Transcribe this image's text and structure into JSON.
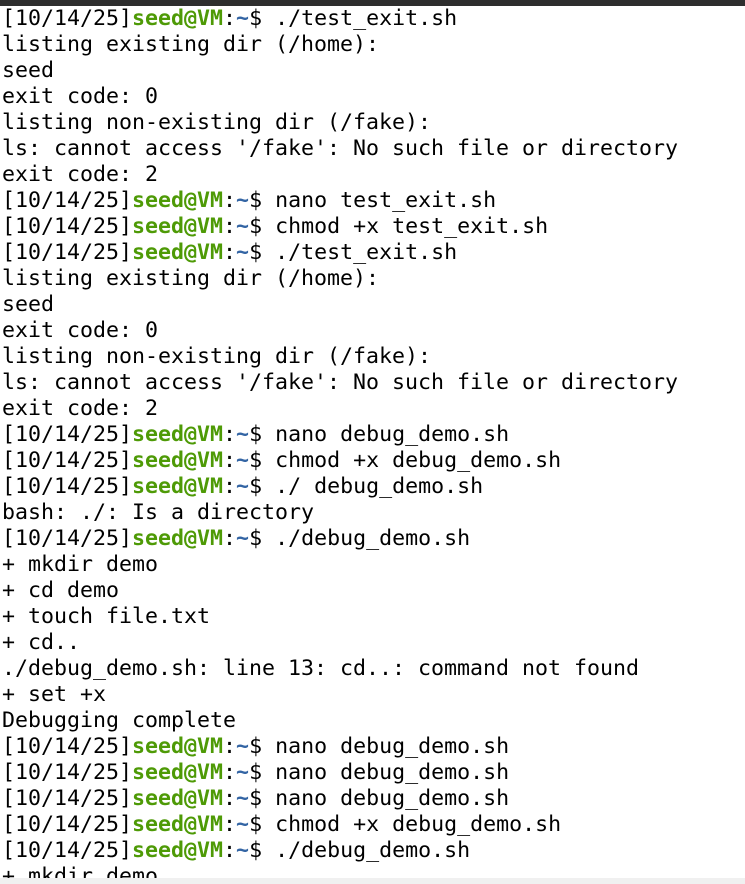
{
  "terminal": {
    "prompt": {
      "date": "[10/14/25]",
      "user_host": "seed@VM",
      "separator": ":",
      "cwd": "~",
      "symbol": "$ "
    },
    "lines": [
      {
        "kind": "prompt",
        "cmd": "./test_exit.sh"
      },
      {
        "kind": "out",
        "text": "listing existing dir (/home):"
      },
      {
        "kind": "out",
        "text": "seed"
      },
      {
        "kind": "out",
        "text": "exit code: 0"
      },
      {
        "kind": "out",
        "text": "listing non-existing dir (/fake):"
      },
      {
        "kind": "out",
        "text": "ls: cannot access '/fake': No such file or directory"
      },
      {
        "kind": "out",
        "text": "exit code: 2"
      },
      {
        "kind": "prompt",
        "cmd": "nano test_exit.sh"
      },
      {
        "kind": "prompt",
        "cmd": "chmod +x test_exit.sh"
      },
      {
        "kind": "prompt",
        "cmd": "./test_exit.sh"
      },
      {
        "kind": "out",
        "text": "listing existing dir (/home):"
      },
      {
        "kind": "out",
        "text": "seed"
      },
      {
        "kind": "out",
        "text": "exit code: 0"
      },
      {
        "kind": "out",
        "text": "listing non-existing dir (/fake):"
      },
      {
        "kind": "out",
        "text": "ls: cannot access '/fake': No such file or directory"
      },
      {
        "kind": "out",
        "text": "exit code: 2"
      },
      {
        "kind": "prompt",
        "cmd": "nano debug_demo.sh"
      },
      {
        "kind": "prompt",
        "cmd": "chmod +x debug_demo.sh"
      },
      {
        "kind": "prompt",
        "cmd": "./ debug_demo.sh"
      },
      {
        "kind": "out",
        "text": "bash: ./: Is a directory"
      },
      {
        "kind": "prompt",
        "cmd": "./debug_demo.sh"
      },
      {
        "kind": "out",
        "text": "+ mkdir demo"
      },
      {
        "kind": "out",
        "text": "+ cd demo"
      },
      {
        "kind": "out",
        "text": "+ touch file.txt"
      },
      {
        "kind": "out",
        "text": "+ cd.."
      },
      {
        "kind": "out",
        "text": "./debug_demo.sh: line 13: cd..: command not found"
      },
      {
        "kind": "out",
        "text": "+ set +x"
      },
      {
        "kind": "out",
        "text": "Debugging complete"
      },
      {
        "kind": "prompt",
        "cmd": "nano debug_demo.sh"
      },
      {
        "kind": "prompt",
        "cmd": "nano debug_demo.sh"
      },
      {
        "kind": "prompt",
        "cmd": "nano debug_demo.sh"
      },
      {
        "kind": "prompt",
        "cmd": "chmod +x debug_demo.sh"
      },
      {
        "kind": "prompt",
        "cmd": "./debug_demo.sh"
      },
      {
        "kind": "out",
        "text": "+ mkdir demo"
      }
    ]
  },
  "colors": {
    "user_host": "#4e9a06",
    "cwd": "#3465a4",
    "text": "#000000",
    "background": "#ffffff"
  }
}
